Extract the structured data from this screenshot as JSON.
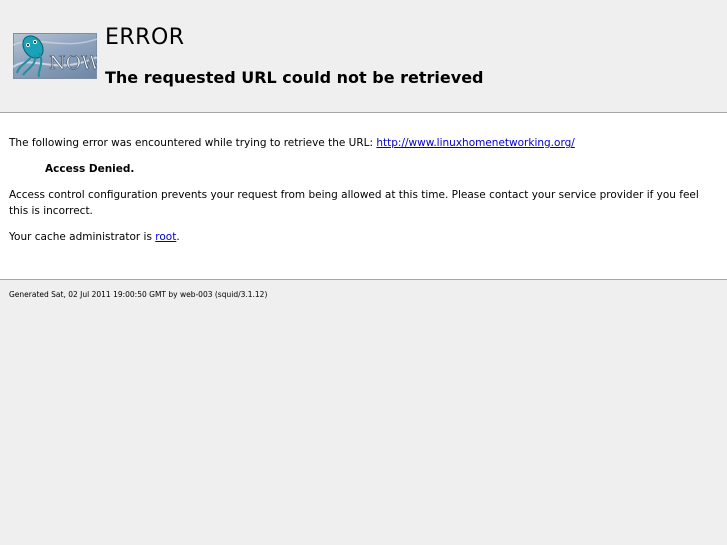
{
  "header": {
    "logo_icon": "squid-now-logo",
    "logo_text": "NOW",
    "title": "ERROR",
    "subtitle": "The requested URL could not be retrieved"
  },
  "content": {
    "intro_text": "The following error was encountered while trying to retrieve the URL: ",
    "url": "http://www.linuxhomenetworking.org/",
    "error_name": "Access Denied.",
    "description": "Access control configuration prevents your request from being allowed at this time. Please contact your service provider if you feel this is incorrect.",
    "admin_prefix": "Your cache administrator is ",
    "admin_link": "root",
    "admin_suffix": "."
  },
  "footer": {
    "generated": "Generated Sat, 02 Jul 2011 19:00:50 GMT by web-003 (squid/3.1.12)"
  }
}
